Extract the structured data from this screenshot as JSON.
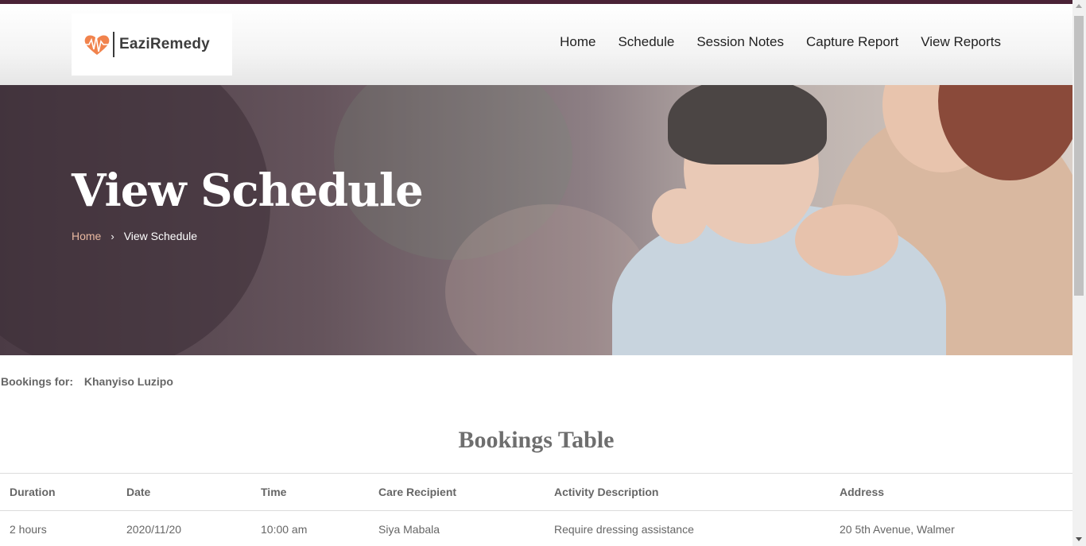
{
  "brand": {
    "name": "EaziRemedy",
    "accent": "#f0753a",
    "theme": "#4a2236"
  },
  "nav": {
    "items": [
      {
        "label": "Home"
      },
      {
        "label": "Schedule"
      },
      {
        "label": "Session Notes"
      },
      {
        "label": "Capture Report"
      },
      {
        "label": "View Reports"
      }
    ]
  },
  "hero": {
    "title": "View Schedule",
    "breadcrumb": {
      "home": "Home",
      "separator": "›",
      "current": "View Schedule"
    }
  },
  "bookings": {
    "label": "Bookings for:",
    "name": "Khanyiso Luzipo",
    "table_title": "Bookings Table",
    "columns": [
      "Duration",
      "Date",
      "Time",
      "Care Recipient",
      "Activity Description",
      "Address"
    ],
    "rows": [
      [
        "2 hours",
        "2020/11/20",
        "10:00 am",
        "Siya Mabala",
        "Require dressing assistance",
        "20 5th Avenue, Walmer"
      ]
    ]
  }
}
